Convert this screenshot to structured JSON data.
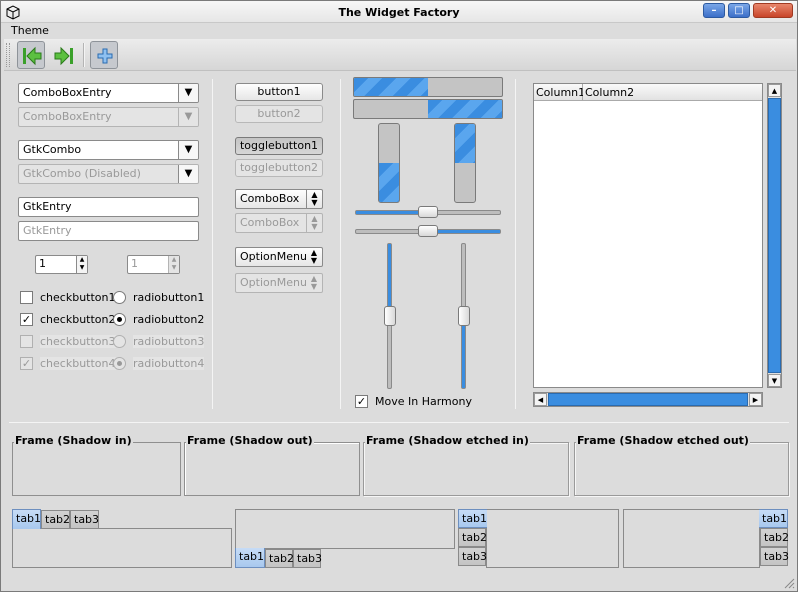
{
  "window": {
    "title": "The Widget Factory",
    "min": "–",
    "max": "□",
    "close": "✕"
  },
  "menu": {
    "theme": "Theme"
  },
  "toolbar": {
    "back": "back",
    "forward": "forward",
    "add": "add"
  },
  "col1": {
    "combo_entry": "ComboBoxEntry",
    "combo_entry_dis": "ComboBoxEntry",
    "gtk_combo": "GtkCombo",
    "gtk_combo_dis": "GtkCombo (Disabled)",
    "entry": "GtkEntry",
    "entry_dis": "GtkEntry",
    "spin": "1",
    "spin_dis": "1",
    "check1": "checkbutton1",
    "check2": "checkbutton2",
    "check3": "checkbutton3",
    "check4": "checkbutton4",
    "radio1": "radiobutton1",
    "radio2": "radiobutton2",
    "radio3": "radiobutton3",
    "radio4": "radiobutton4"
  },
  "col2": {
    "button1": "button1",
    "button2": "button2",
    "toggle1": "togglebutton1",
    "toggle2": "togglebutton2",
    "combobox": "ComboBox",
    "combobox_dis": "ComboBox",
    "optmenu": "OptionMenu",
    "optmenu_dis": "OptionMenu"
  },
  "col3": {
    "hprogress1": 0.5,
    "hprogress2": 0.5,
    "vprogress1": 0.5,
    "vprogress2": 0.5,
    "hscale1": 0.5,
    "hscale2": 0.5,
    "vscale1": 0.5,
    "vscale2": 0.5,
    "harmony": "Move In Harmony"
  },
  "treeview": {
    "columns": [
      "Column1",
      "Column2"
    ]
  },
  "frames": {
    "shadow_in": "Frame (Shadow in)",
    "shadow_out": "Frame (Shadow out)",
    "etched_in": "Frame (Shadow etched in)",
    "etched_out": "Frame (Shadow etched out)"
  },
  "notebooks": {
    "tabs": [
      "tab1",
      "tab2",
      "tab3"
    ]
  },
  "colors": {
    "accent": "#3a8de0",
    "bg": "#dcdcdc"
  }
}
